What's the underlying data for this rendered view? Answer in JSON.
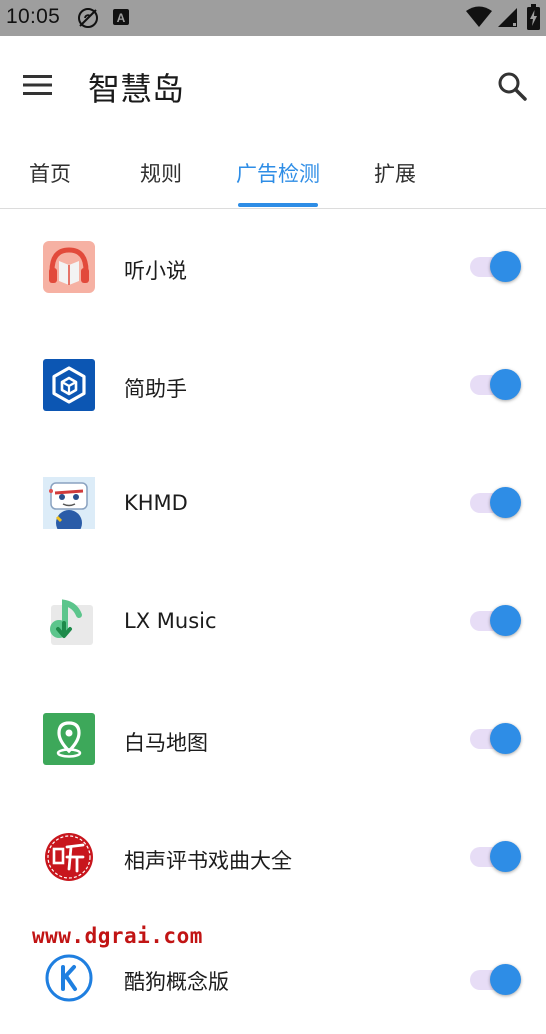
{
  "status_bar": {
    "time": "10:05",
    "icons": [
      "sync-off-icon",
      "a-notification-icon",
      "wifi-icon",
      "signal-icon",
      "battery-charging-icon"
    ]
  },
  "app_bar": {
    "title": "智慧岛",
    "menu_icon": "hamburger-menu-icon",
    "search_icon": "search-icon"
  },
  "tabs": [
    {
      "label": "首页",
      "active": false
    },
    {
      "label": "规则",
      "active": false
    },
    {
      "label": "广告检测",
      "active": true
    },
    {
      "label": "扩展",
      "active": false
    }
  ],
  "accent_color": "#2e8de6",
  "apps": [
    {
      "name": "听小说",
      "icon": "headphones-book-icon",
      "enabled": true
    },
    {
      "name": "简助手",
      "icon": "cube-icon",
      "enabled": true
    },
    {
      "name": "KHMD",
      "icon": "cartoon-robot-icon",
      "enabled": true
    },
    {
      "name": "LX Music",
      "icon": "music-note-download-icon",
      "enabled": true
    },
    {
      "name": "白马地图",
      "icon": "map-pin-icon",
      "enabled": true
    },
    {
      "name": "相声评书戏曲大全",
      "icon": "listen-seal-icon",
      "enabled": true
    },
    {
      "name": "酷狗概念版",
      "icon": "kugou-k-icon",
      "enabled": true
    }
  ],
  "watermark": "www.dgrai.com"
}
